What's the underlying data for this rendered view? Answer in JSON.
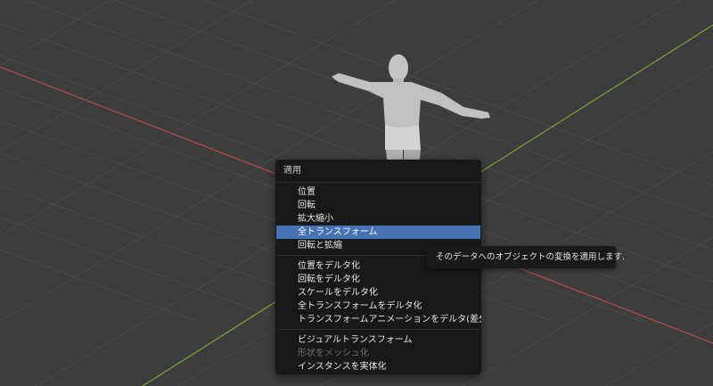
{
  "menu": {
    "title": "適用",
    "groups": [
      [
        {
          "label": "位置"
        },
        {
          "label": "回転"
        },
        {
          "label": "拡大縮小"
        },
        {
          "label": "全トランスフォーム",
          "state": "highlighted"
        },
        {
          "label": "回転と拡縮"
        }
      ],
      [
        {
          "label": "位置をデルタ化"
        },
        {
          "label": "回転をデルタ化"
        },
        {
          "label": "スケールをデルタ化"
        },
        {
          "label": "全トランスフォームをデルタ化"
        },
        {
          "label": "トランスフォームアニメーションをデルタ(差分)に"
        }
      ],
      [
        {
          "label": "ビジュアルトランスフォーム"
        },
        {
          "label": "形状をメッシュ化",
          "state": "disabled"
        },
        {
          "label": "インスタンスを実体化"
        }
      ]
    ]
  },
  "tooltip": {
    "text": "そのデータへのオブジェクトの変換を適用します."
  },
  "colors": {
    "viewport_bg": "#3d3d3d",
    "grid": "#4a4a4a",
    "x_axis": "#b34a4f",
    "y_axis": "#7aa33a",
    "menu_bg": "#181818",
    "highlight": "#4772b3",
    "model": "#bdbdbd"
  }
}
